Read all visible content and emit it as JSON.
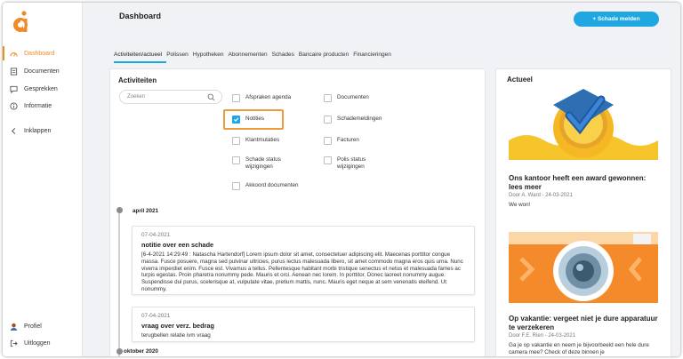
{
  "colors": {
    "accent": "#f08a24",
    "primary": "#1ea7e1",
    "highlight": "#f09a3e"
  },
  "sidebar": {
    "logo": "logo-icon",
    "items": [
      {
        "label": "Dashboard",
        "icon": "dashboard-icon",
        "active": true
      },
      {
        "label": "Documenten",
        "icon": "document-icon"
      },
      {
        "label": "Gesprekken",
        "icon": "chat-icon"
      },
      {
        "label": "Informatie",
        "icon": "info-icon"
      },
      {
        "label": "Inklappen",
        "icon": "chevron-left-icon"
      }
    ],
    "bottom": [
      {
        "label": "Profiel",
        "icon": "avatar-icon"
      },
      {
        "label": "Uitloggen",
        "icon": "logout-icon"
      }
    ]
  },
  "header": {
    "title": "Dashboard",
    "action_label": "+ Schade melden"
  },
  "tabs": [
    {
      "label": "Activiteiten/actueel",
      "active": true
    },
    {
      "label": "Polissen"
    },
    {
      "label": "Hypotheken"
    },
    {
      "label": "Abonnementen"
    },
    {
      "label": "Schades"
    },
    {
      "label": "Bancaire producten"
    },
    {
      "label": "Financieringen"
    }
  ],
  "activiteiten": {
    "title": "Activiteiten",
    "search_placeholder": "Zoeken",
    "filters": [
      {
        "label": "Afspraken agenda",
        "checked": false
      },
      {
        "label": "Documenten",
        "checked": false
      },
      {
        "label": "Notities",
        "checked": true
      },
      {
        "label": "Schademeldingen",
        "checked": false
      },
      {
        "label": "Klantmutaties",
        "checked": false
      },
      {
        "label": "Facturen",
        "checked": false
      },
      {
        "label": "Schade status wijzigingen",
        "checked": false
      },
      {
        "label": "Polis status wijzigingen",
        "checked": false
      },
      {
        "label": "Akkoord documenten",
        "checked": false
      }
    ],
    "timeline": [
      {
        "month": "april 2021"
      },
      {
        "month": "oktober 2020"
      }
    ],
    "entries": [
      {
        "date": "07-04-2021",
        "title": "notitie over een schade",
        "body": "[6-4-2021 14:29:49 : Natascha Hartendorf] Lorem ipsum dolor sit amet, consectetuer adipiscing elit. Maecenas porttitor congue massa. Fusce posuere, magna sed pulvinar ultricies, purus lectus malesuada libero, sit amet commodo magna eros quis urna. Nunc viverra imperdiet enim. Fusce est. Vivamus a tellus. Pellentesque habitant morbi tristique senectus et netus et malesuada fames ac turpis egestas. Proin pharetra nonummy pede. Mauris et orci. Aenean nec lorem. In porttitor. Donec laoreet nonummy augue. Suspendisse dui purus, scelerisque at, vulputate vitae, pretium mattis, nunc. Mauris eget neque at sem venenatis eleifend. Ut nonummy."
      },
      {
        "date": "07-04-2021",
        "title": "vraag over verz. bedrag",
        "body": "terugbellen relatie ivm vraag"
      }
    ]
  },
  "actueel": {
    "title": "Actueel",
    "news": [
      {
        "title": "Ons kantoor heeft een award gewonnen: lees meer",
        "meta": "Door A. Ward - 24-03-2021",
        "text": "We won!"
      },
      {
        "title": "Op vakantie: vergeet niet je dure apparatuur te verzekeren",
        "meta": "Door F.E. Rien - 24-03-2021",
        "text": "Ga je op vakantie en neem je bijvoorbeeld een hele dure camera mee? Check of deze binnen je"
      }
    ]
  }
}
